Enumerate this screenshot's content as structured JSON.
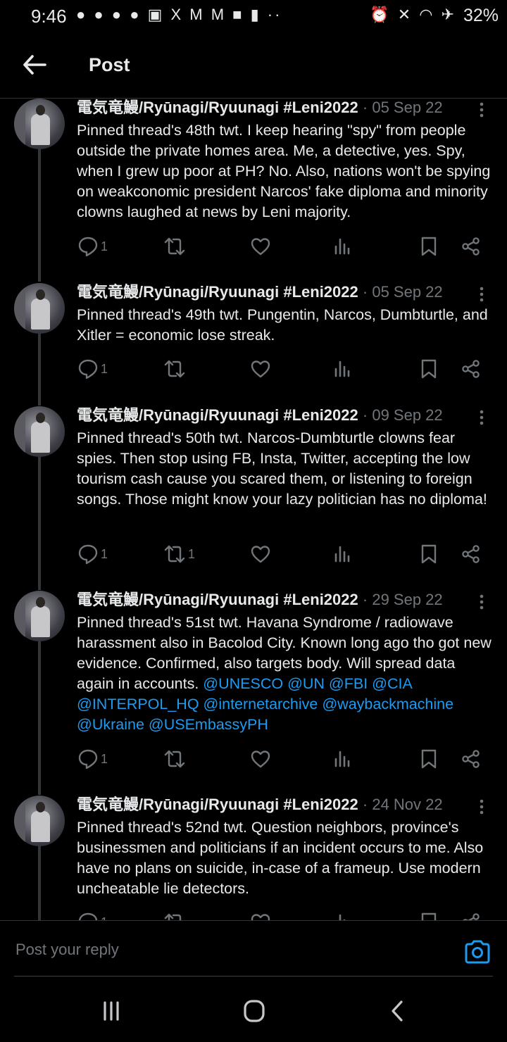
{
  "status_bar": {
    "time": "9:46",
    "left_icons": "● ● ● ● ▣ X M M ■ ▮ ··",
    "right_icons": "⏰ ✕ ◠ ✈",
    "battery": "32%"
  },
  "header": {
    "title": "Post",
    "back_icon": "arrow-left-icon"
  },
  "posts": [
    {
      "author": "電気竜鰻/Ryūnagi/Ryuunagi #Leni2022",
      "date": "05 Sep 22",
      "text": "Pinned thread's 48th twt. I keep hearing \"spy\" from people outside the private homes area. Me, a detective, yes. Spy, when I grew up poor at PH? No. Also, nations won't be spying on weakconomic president Narcos' fake diploma and minority clowns laughed at news by Leni majority.",
      "mentions": "",
      "replies": "1",
      "reposts": "",
      "likes": ""
    },
    {
      "author": "電気竜鰻/Ryūnagi/Ryuunagi #Leni2022",
      "date": "05 Sep 22",
      "text": "Pinned thread's 49th twt. Pungentin, Narcos, Dumbturtle, and Xitler = economic lose streak.",
      "mentions": "",
      "replies": "1",
      "reposts": "",
      "likes": ""
    },
    {
      "author": "電気竜鰻/Ryūnagi/Ryuunagi #Leni2022",
      "date": "09 Sep 22",
      "text": "Pinned thread's 50th twt. Narcos-Dumbturtle clowns fear spies. Then stop using FB, Insta, Twitter, accepting the low tourism cash cause you scared them, or listening to foreign songs. Those might know your lazy politician has no diploma!",
      "mentions": "",
      "replies": "1",
      "reposts": "1",
      "likes": ""
    },
    {
      "author": "電気竜鰻/Ryūnagi/Ryuunagi #Leni2022",
      "date": "29 Sep 22",
      "text": "Pinned thread's 51st twt. Havana Syndrome / radiowave harassment also in Bacolod City. Known long ago tho got new evidence. Confirmed, also targets body. Will spread data again in accounts. ",
      "mentions": "@UNESCO @UN @FBI @CIA @INTERPOL_HQ @internetarchive @waybackmachine @Ukraine @USEmbassyPH",
      "replies": "1",
      "reposts": "",
      "likes": ""
    },
    {
      "author": "電気竜鰻/Ryūnagi/Ryuunagi #Leni2022",
      "date": "24 Nov 22",
      "text": "Pinned thread's 52nd twt. Question neighbors, province's businessmen and politicians if an incident occurs to me. Also have no plans on suicide, in-case of a frameup. Use modern uncheatable lie detectors.",
      "mentions": "",
      "replies": "1",
      "reposts": "",
      "likes": ""
    }
  ],
  "composer": {
    "placeholder": "Post your reply",
    "camera_icon": "camera-icon"
  },
  "colors": {
    "background": "#000000",
    "text": "#e7e9ea",
    "muted": "#71767b",
    "accent": "#1d9bf0",
    "divider": "#2f3336"
  }
}
